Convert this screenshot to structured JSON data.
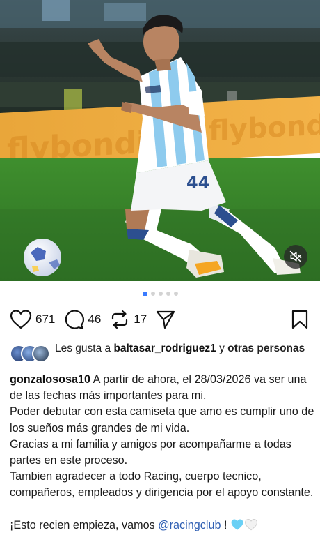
{
  "post": {
    "stats": {
      "likes": "671",
      "comments": "46",
      "reposts": "17"
    },
    "carousel": {
      "total": 5,
      "active_index": 0
    },
    "liked_by": {
      "prefix": "Les gusta a ",
      "user": "baltasar_rodriguez1",
      "connector": " y ",
      "others": "otras personas"
    },
    "caption": {
      "username": "gonzalososa10",
      "line1": " A partir de ahora, el 28/03/2026 va ser una de las fechas más importantes para mi.",
      "line2": "Poder debutar con esta camiseta que amo es cumplir uno de los sueños más grandes de mi vida.",
      "line3": "Gracias a mi familia y amigos por acompañarme a todas partes en este proceso.",
      "line4": "Tambien agradecer a todo Racing, cuerpo tecnico, compañeros, empleados y dirigencia por el apoyo constante.",
      "line5_prefix": "¡Esto recien empieza, vamos ",
      "mention": "@racingclub",
      "line5_suffix": " !"
    },
    "photo": {
      "jersey_number": "44",
      "banner_text": "flybondi"
    }
  },
  "colors": {
    "accent_blue": "#3a7bff",
    "mention": "#2f5fb3",
    "heart_blue": "#6ad0f5"
  }
}
